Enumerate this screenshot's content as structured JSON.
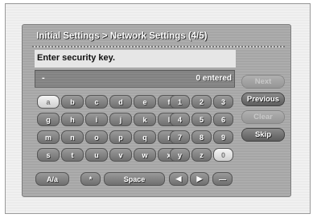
{
  "dialog": {
    "title": "Initial Settings > Network Settings (4/5)",
    "prompt": "Enter security key.",
    "entry_value": "-",
    "entry_count": "0 entered"
  },
  "keyboard": {
    "rows": [
      [
        "a",
        "b",
        "c",
        "d",
        "e",
        "f"
      ],
      [
        "g",
        "h",
        "i",
        "j",
        "k",
        "l"
      ],
      [
        "m",
        "n",
        "o",
        "p",
        "q",
        "r"
      ],
      [
        "s",
        "t",
        "u",
        "v",
        "w",
        "x"
      ]
    ],
    "numbers": [
      [
        "1",
        "2",
        "3"
      ],
      [
        "4",
        "5",
        "6"
      ],
      [
        "7",
        "8",
        "9"
      ],
      [
        "y",
        "z",
        "0"
      ]
    ],
    "bottom": {
      "aa_label": "A/a",
      "at_label": "*",
      "space_label": "Space",
      "left_label": "◀",
      "right_label": "▶",
      "dash_label": "—"
    }
  },
  "sidebar": {
    "done_label": "Next",
    "previous_label": "Previous",
    "clear_label": "Clear",
    "skip_label": "Skip"
  }
}
